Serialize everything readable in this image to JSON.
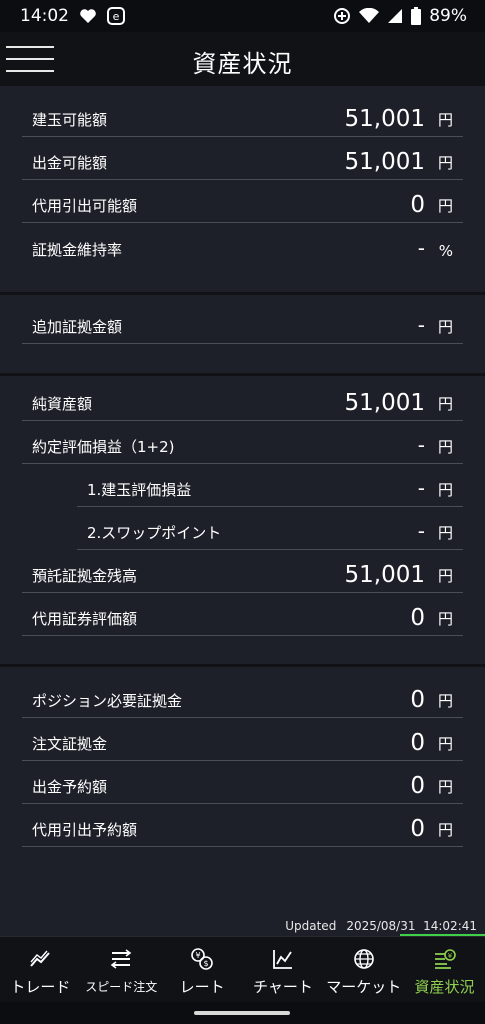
{
  "status_bar": {
    "time": "14:02",
    "battery": "89%"
  },
  "header": {
    "title": "資産状況"
  },
  "sections": [
    {
      "rows": [
        {
          "label": "建玉可能額",
          "value": "51,001",
          "unit": "円"
        },
        {
          "label": "出金可能額",
          "value": "51,001",
          "unit": "円"
        },
        {
          "label": "代用引出可能額",
          "value": "0",
          "unit": "円"
        },
        {
          "label": "証拠金維持率",
          "value": "-",
          "unit": "%"
        }
      ]
    },
    {
      "rows": [
        {
          "label": "追加証拠金額",
          "value": "-",
          "unit": "円"
        }
      ]
    },
    {
      "rows": [
        {
          "label": "純資産額",
          "value": "51,001",
          "unit": "円"
        },
        {
          "label": "約定評価損益（1+2)",
          "value": "-",
          "unit": "円"
        },
        {
          "label": "1.建玉評価損益",
          "value": "-",
          "unit": "円"
        },
        {
          "label": "2.スワップポイント",
          "value": "-",
          "unit": "円"
        },
        {
          "label": "預託証拠金残高",
          "value": "51,001",
          "unit": "円"
        },
        {
          "label": "代用証券評価額",
          "value": "0",
          "unit": "円"
        }
      ]
    },
    {
      "rows": [
        {
          "label": "ポジション必要証拠金",
          "value": "0",
          "unit": "円"
        },
        {
          "label": "注文証拠金",
          "value": "0",
          "unit": "円"
        },
        {
          "label": "出金予約額",
          "value": "0",
          "unit": "円"
        },
        {
          "label": "代用引出予約額",
          "value": "0",
          "unit": "円"
        }
      ]
    }
  ],
  "updated": {
    "label": "Updated",
    "timestamp": "2025/08/31  14:02:41"
  },
  "bottom_nav": {
    "items": [
      {
        "label": "トレード",
        "icon": "trade-chart-icon"
      },
      {
        "label": "スピード注文",
        "icon": "speed-order-icon"
      },
      {
        "label": "レート",
        "icon": "rate-currency-icon"
      },
      {
        "label": "チャート",
        "icon": "chart-icon"
      },
      {
        "label": "マーケット",
        "icon": "globe-icon"
      },
      {
        "label": "資産状況",
        "icon": "assets-icon"
      }
    ],
    "active_index": 5
  },
  "colors": {
    "background": "#1e2029",
    "header": "#111216",
    "accent": "#8fd14f",
    "divider": "#4a4c56"
  }
}
